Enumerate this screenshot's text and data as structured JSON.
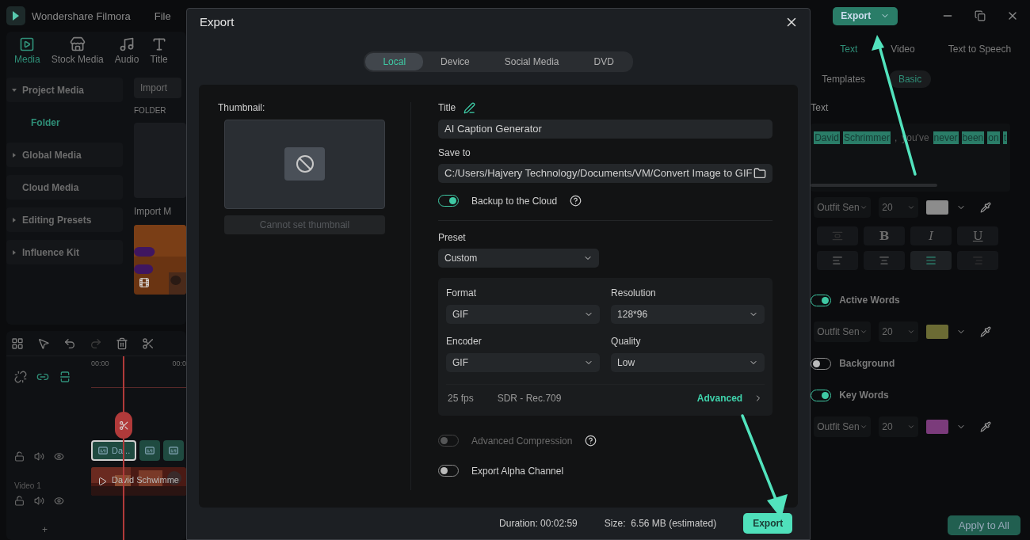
{
  "app": {
    "name": "Wondershare Filmora",
    "menu": [
      "File"
    ]
  },
  "media_tabs": [
    {
      "label": "Media",
      "selected": true
    },
    {
      "label": "Stock Media",
      "selected": false
    },
    {
      "label": "Audio",
      "selected": false
    },
    {
      "label": "Title",
      "selected": false
    }
  ],
  "sidebar": {
    "items": [
      {
        "label": "Project Media",
        "selected": false,
        "expanded": true,
        "children": [
          {
            "label": "Folder",
            "selected": true
          }
        ]
      },
      {
        "label": "Global Media",
        "selected": false,
        "expanded": false
      },
      {
        "label": "Cloud Media",
        "selected": false
      },
      {
        "label": "Editing Presets",
        "selected": false,
        "expanded": false
      },
      {
        "label": "Influence Kit",
        "selected": false,
        "expanded": false
      }
    ]
  },
  "media": {
    "import_button": "Import",
    "folder_header": "FOLDER",
    "import_label": "Import M"
  },
  "timeline": {
    "ruler": [
      "00:00",
      "00:0"
    ],
    "caption_clips": [
      {
        "label": "Da...",
        "selected": true
      },
      {
        "selected": false
      },
      {
        "selected": false
      }
    ],
    "video_track": {
      "label": "Video 1",
      "clip": "David Schwimme"
    },
    "add_track": "+"
  },
  "export_dialog": {
    "title": "Export",
    "tabs": [
      {
        "label": "Local",
        "selected": true
      },
      {
        "label": "Device",
        "selected": false
      },
      {
        "label": "Social Media",
        "selected": false
      },
      {
        "label": "DVD",
        "selected": false
      }
    ],
    "thumbnail": {
      "label": "Thumbnail:",
      "button": "Cannot set thumbnail",
      "disabled": true
    },
    "title_field": {
      "label": "Title",
      "value": "AI Caption Generator"
    },
    "save_to": {
      "label": "Save to",
      "value": "C:/Users/Hajvery Technology/Documents/VM/Convert Image to GIF"
    },
    "backup": {
      "label": "Backup to the Cloud",
      "on": true
    },
    "preset": {
      "label": "Preset",
      "value": "Custom"
    },
    "settings": [
      {
        "label": "Format",
        "value": "GIF"
      },
      {
        "label": "Resolution",
        "value": "128*96"
      },
      {
        "label": "Encoder",
        "value": "GIF"
      },
      {
        "label": "Quality",
        "value": "Low"
      }
    ],
    "frame_rate": "25 fps",
    "color_space": "SDR - Rec.709",
    "advanced_link": "Advanced",
    "options": [
      {
        "label": "Advanced Compression",
        "on": false,
        "disabled": true,
        "help": true
      },
      {
        "label": "Export Alpha Channel",
        "on": false,
        "disabled": false,
        "help": false
      }
    ],
    "duration": "Duration: 00:02:59",
    "size": "Size:  6.56 MB (estimated)",
    "export_button": "Export"
  },
  "top_export_button": "Export",
  "properties": {
    "tabs": [
      {
        "label": "Text",
        "selected": true
      },
      {
        "label": "Video",
        "selected": false
      },
      {
        "label": "Text to Speech",
        "selected": false
      }
    ],
    "subtabs": [
      {
        "label": "Templates",
        "selected": false
      },
      {
        "label": "Basic",
        "selected": true
      }
    ],
    "section": "Text",
    "caption_words": [
      {
        "text": "David",
        "highlighted": true
      },
      {
        "text": "Schrimmer",
        "highlighted": true
      },
      {
        "text": ",",
        "highlighted": false
      },
      {
        "text": "you've",
        "highlighted": false
      },
      {
        "text": "never",
        "highlighted": true
      },
      {
        "text": "been",
        "highlighted": true
      },
      {
        "text": "on",
        "highlighted": true
      },
      {
        "text": "t",
        "highlighted": true
      }
    ],
    "text_font": {
      "font": "Outfit Sen",
      "size": "20",
      "color": "#8c8c8c"
    },
    "styles": [
      {
        "kind": "icon",
        "disabled": true
      },
      {
        "kind": "text",
        "label": "B",
        "disabled": false
      },
      {
        "kind": "text",
        "label": "I",
        "disabled": false
      },
      {
        "kind": "text",
        "label": "U",
        "disabled": false
      }
    ],
    "aligns": [
      {
        "kind": "left",
        "selected": false,
        "disabled": false
      },
      {
        "kind": "center",
        "selected": false,
        "disabled": false
      },
      {
        "kind": "justify",
        "selected": true,
        "disabled": false
      },
      {
        "kind": "right",
        "selected": false,
        "disabled": true
      }
    ],
    "groups": [
      {
        "label": "Active Words",
        "on": true,
        "font": {
          "font": "Outfit Sen",
          "size": "20",
          "color": "#6b6b34"
        }
      },
      {
        "label": "Background",
        "on": false
      },
      {
        "label": "Key Words",
        "on": true,
        "font": {
          "font": "Outfit Sen",
          "size": "20",
          "color": "#7b3b7b"
        }
      }
    ],
    "apply_button": "Apply to All"
  }
}
